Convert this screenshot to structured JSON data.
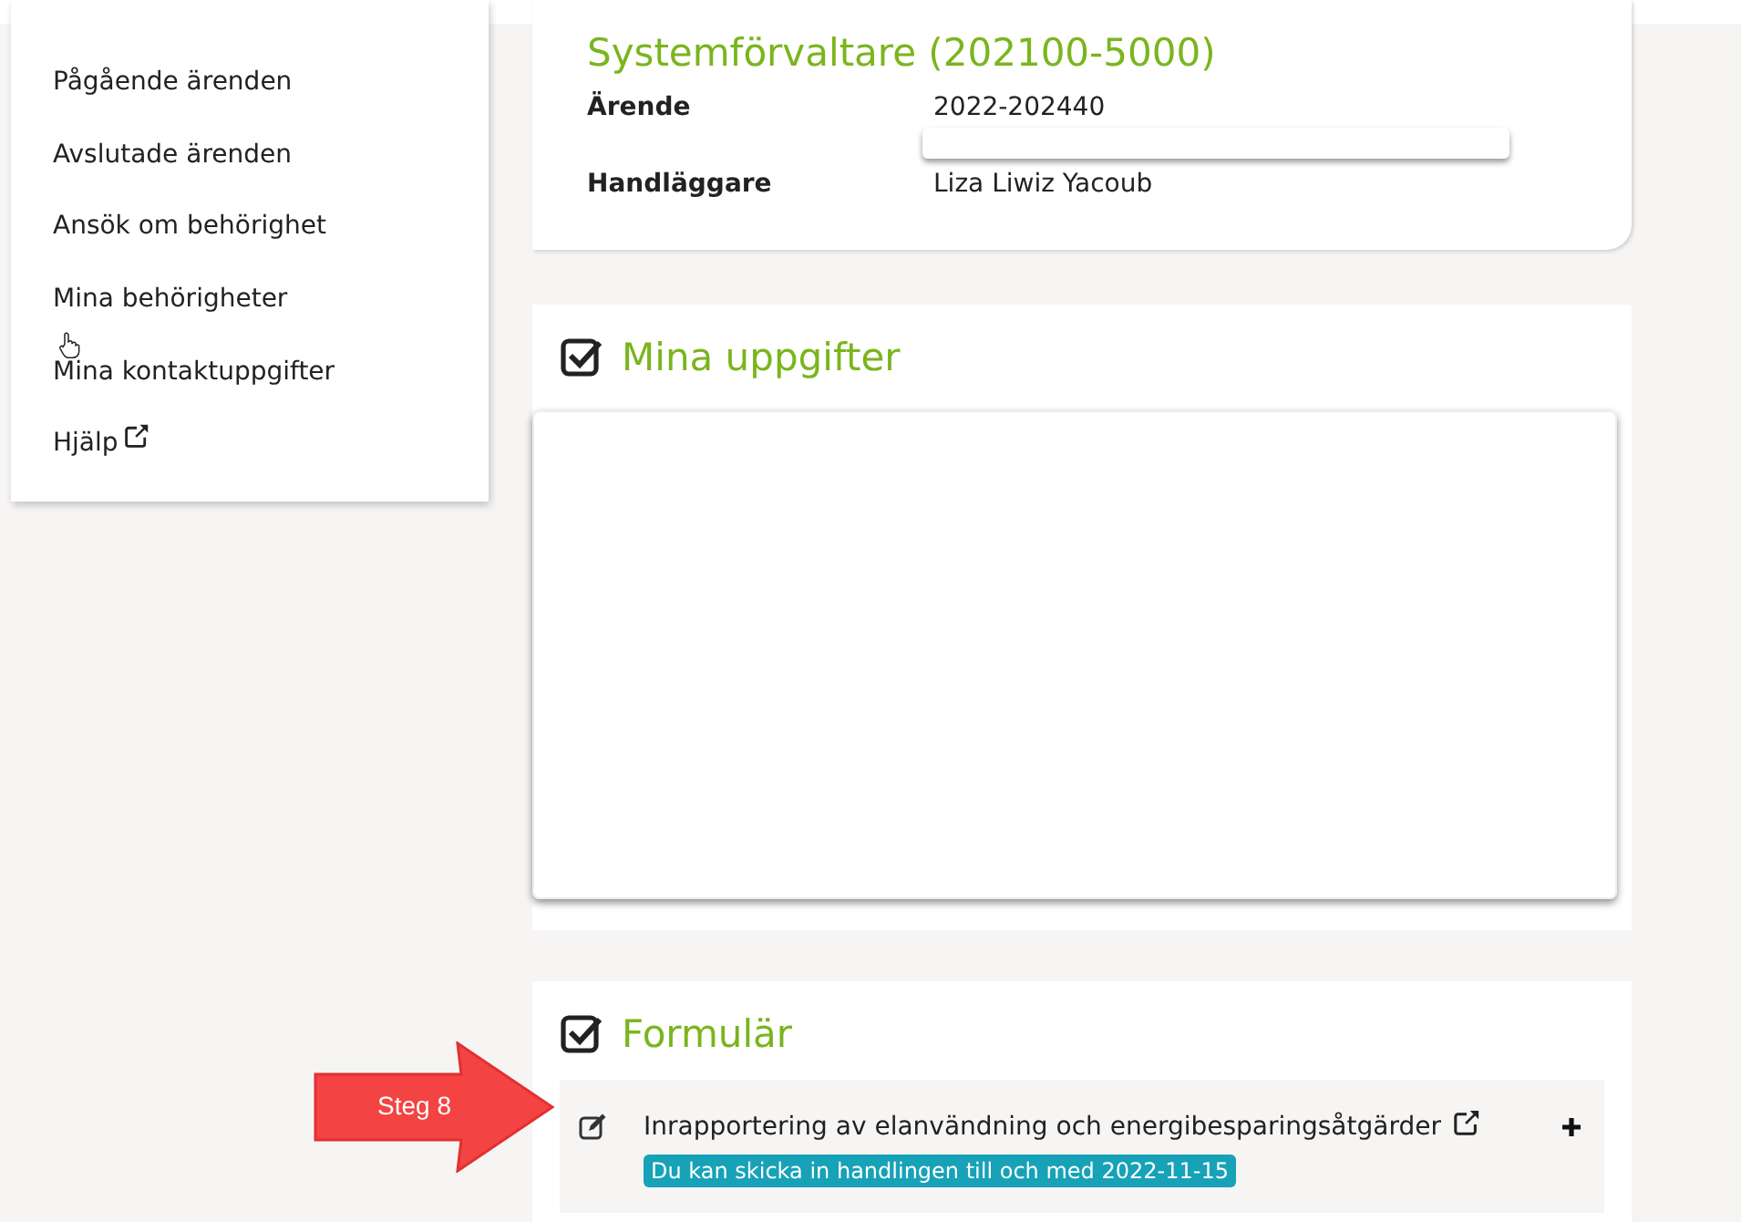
{
  "menu": {
    "items": [
      {
        "label": "Pågående ärenden",
        "kind": "link"
      },
      {
        "label": "Avslutade ärenden",
        "kind": "link"
      },
      {
        "label": "Ansök om behörighet",
        "kind": "link"
      },
      {
        "label": "Mina behörigheter",
        "kind": "link"
      },
      {
        "label": "Mina kontaktuppgifter",
        "kind": "link"
      },
      {
        "label": "Hjälp",
        "kind": "external"
      }
    ]
  },
  "case_card": {
    "title": "Systemförvaltare (202100-5000)",
    "fields": [
      {
        "label": "Ärende",
        "value": "2022-202440"
      },
      {
        "label": "Handläggare",
        "value": "Liza Liwiz Yacoub"
      }
    ]
  },
  "tasks": {
    "title": "Mina uppgifter"
  },
  "forms": {
    "title": "Formulär",
    "items": [
      {
        "title": "Inrapportering av elanvändning och energibesparingsåtgärder",
        "deadline": "Du kan skicka in handlingen till och med 2022-11-15"
      }
    ]
  },
  "annotation": {
    "label": "Steg 8"
  }
}
